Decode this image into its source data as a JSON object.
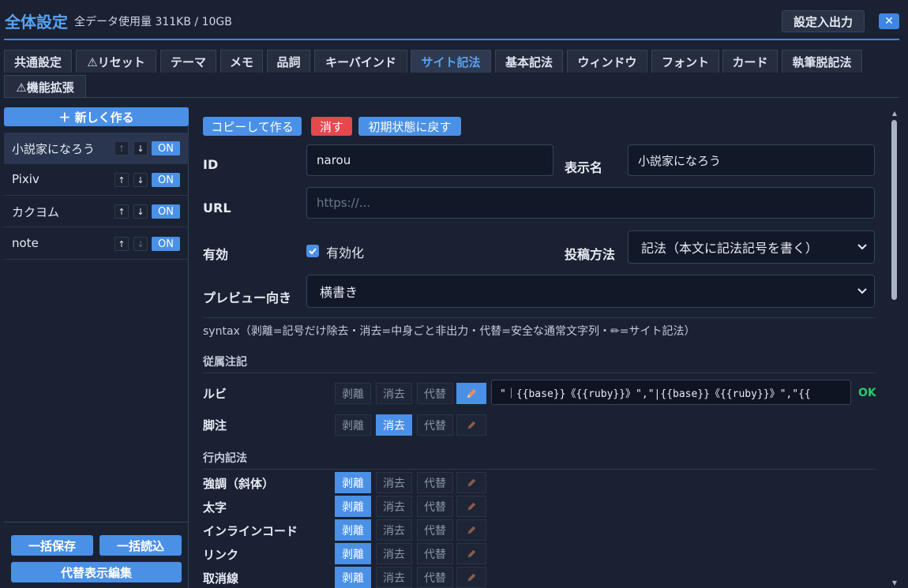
{
  "header": {
    "title": "全体設定",
    "usage": "全データ使用量 311KB / 10GB",
    "io_button": "設定入出力",
    "close_glyph": "✕"
  },
  "tabs": [
    {
      "label": "共通設定"
    },
    {
      "label": "⚠リセット"
    },
    {
      "label": "テーマ"
    },
    {
      "label": "メモ"
    },
    {
      "label": "品詞"
    },
    {
      "label": "キーバインド"
    },
    {
      "label": "サイト記法",
      "active": true
    },
    {
      "label": "基本記法"
    },
    {
      "label": "ウィンドウ"
    },
    {
      "label": "フォント"
    },
    {
      "label": "カード"
    },
    {
      "label": "執筆脱記法"
    },
    {
      "label": "⚠機能拡張"
    }
  ],
  "sidebar": {
    "new_button": "＋ 新しく作る",
    "sites": [
      {
        "name": "小説家になろう",
        "up": "↑",
        "down": "↓",
        "toggle": "ON",
        "selected": true
      },
      {
        "name": "Pixiv",
        "up": "↑",
        "down": "↓",
        "toggle": "ON"
      },
      {
        "name": "カクヨム",
        "up": "↑",
        "down": "↓",
        "toggle": "ON"
      },
      {
        "name": "note",
        "up": "↑",
        "down": "↓",
        "toggle": "ON"
      }
    ],
    "bulk_save": "一括保存",
    "bulk_load": "一括読込",
    "alt_edit": "代替表示編集"
  },
  "actions": {
    "copy": "コピーして作る",
    "delete": "消す",
    "reset": "初期状態に戻す"
  },
  "form": {
    "id_label": "ID",
    "id_value": "narou",
    "display_label": "表示名",
    "display_value": "小説家になろう",
    "url_label": "URL",
    "url_placeholder": "https://...",
    "enabled_label": "有効",
    "enabled_checkbox": "有効化",
    "post_label": "投稿方法",
    "post_value": "記法（本文に記法記号を書く）",
    "preview_label": "プレビュー向き",
    "preview_value": "横書き"
  },
  "syntax_note": "syntax（剥離=記号だけ除去・消去=中身ごと非出力・代替=安全な通常文字列・✏=サイト記法）",
  "modes": {
    "strip": "剥離",
    "erase": "消去",
    "alt": "代替"
  },
  "sections": [
    {
      "title": "従属注記",
      "rows": [
        {
          "label": "ルビ",
          "active": "pencil"
        },
        {
          "label": "脚注",
          "active": "erase"
        }
      ]
    },
    {
      "title": "行内記法",
      "rows": [
        {
          "label": "強調（斜体）",
          "active": "strip"
        },
        {
          "label": "太字",
          "active": "strip"
        },
        {
          "label": "インラインコード",
          "active": "strip"
        },
        {
          "label": "リンク",
          "active": "strip"
        },
        {
          "label": "取消線",
          "active": "strip"
        }
      ]
    }
  ],
  "ruby_template": "\"｜{{base}}《{{ruby}}》\",\"|{{base}}《{{ruby}}》\",\"{{",
  "ruby_status": "OK",
  "colors": {
    "accent": "#4a90e6",
    "danger": "#e5484d",
    "ok": "#29c96e",
    "background": "#1a2132"
  }
}
